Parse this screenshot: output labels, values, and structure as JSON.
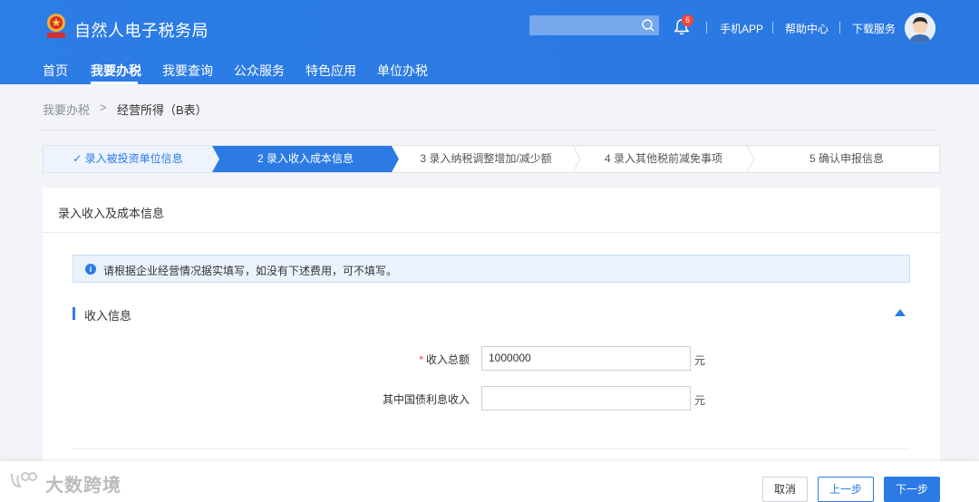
{
  "header": {
    "site_title": "自然人电子税务局",
    "notification_count": "6",
    "links": [
      "手机APP",
      "帮助中心",
      "下载服务"
    ],
    "nav": [
      "首页",
      "我要办税",
      "我要查询",
      "公众服务",
      "特色应用",
      "单位办税"
    ],
    "active_nav": "我要办税"
  },
  "breadcrumb": {
    "home": "我要办税",
    "separator": ">",
    "current": "经营所得（B表）"
  },
  "steps": [
    {
      "label": "✓ 录入被投资单位信息",
      "state": "done"
    },
    {
      "label": "2 录入收入成本信息",
      "state": "active"
    },
    {
      "label": "3 录入纳税调整增加/减少额",
      "state": "pending"
    },
    {
      "label": "4 录入其他税前减免事项",
      "state": "pending"
    },
    {
      "label": "5 确认申报信息",
      "state": "pending"
    }
  ],
  "card": {
    "title": "录入收入及成本信息",
    "notice_icon": "i",
    "notice": "请根据企业经营情况据实填写，如没有下述费用，可不填写。",
    "section_title": "收入信息",
    "fields": [
      {
        "required": "*",
        "label": "收入总额",
        "value": "1000000",
        "unit": "元"
      },
      {
        "required": "",
        "label": "其中国债利息收入",
        "value": "",
        "unit": "元"
      }
    ]
  },
  "footer": {
    "watermark": "大数跨境",
    "cancel": "取消",
    "prev": "上一步",
    "next": "下一步"
  },
  "colors": {
    "primary": "#2c7be5",
    "required": "#f44336"
  }
}
